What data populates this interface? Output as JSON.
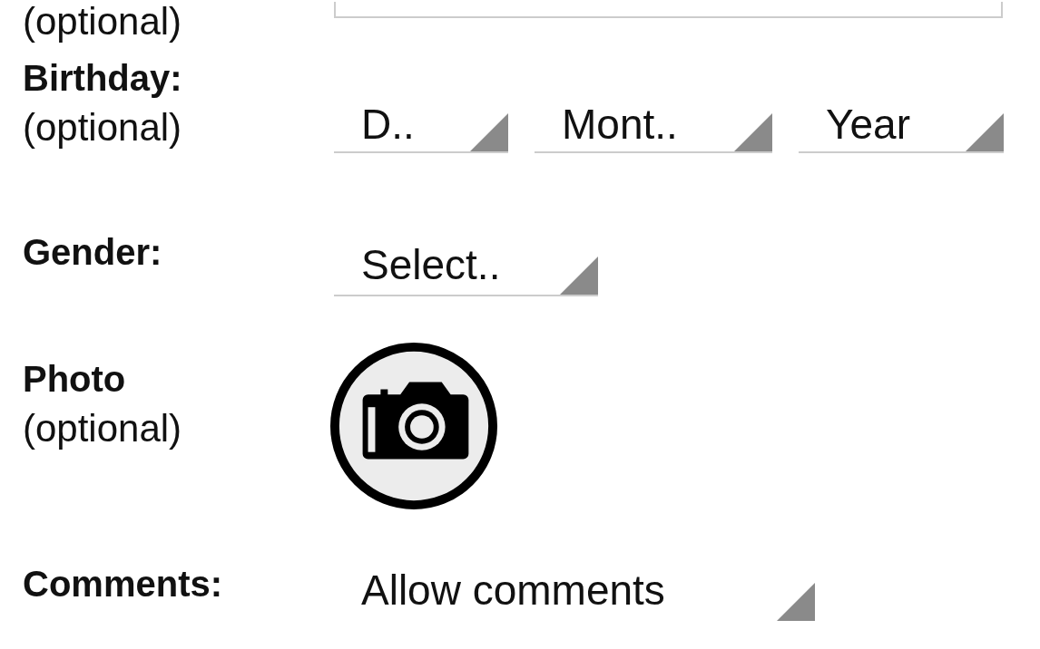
{
  "top_field": {
    "note": "(optional)"
  },
  "fields": [
    {
      "kind": "date",
      "label": "Birthday:",
      "note": "(optional)",
      "spinners": [
        {
          "text": "D.."
        },
        {
          "text": "Mont.."
        },
        {
          "text": "Year"
        }
      ]
    },
    {
      "kind": "select",
      "label": "Gender:",
      "text": "Select.."
    },
    {
      "kind": "photo",
      "label": "Photo",
      "note": "(optional)"
    },
    {
      "kind": "select",
      "label": "Comments:",
      "text": "Allow comments"
    }
  ]
}
